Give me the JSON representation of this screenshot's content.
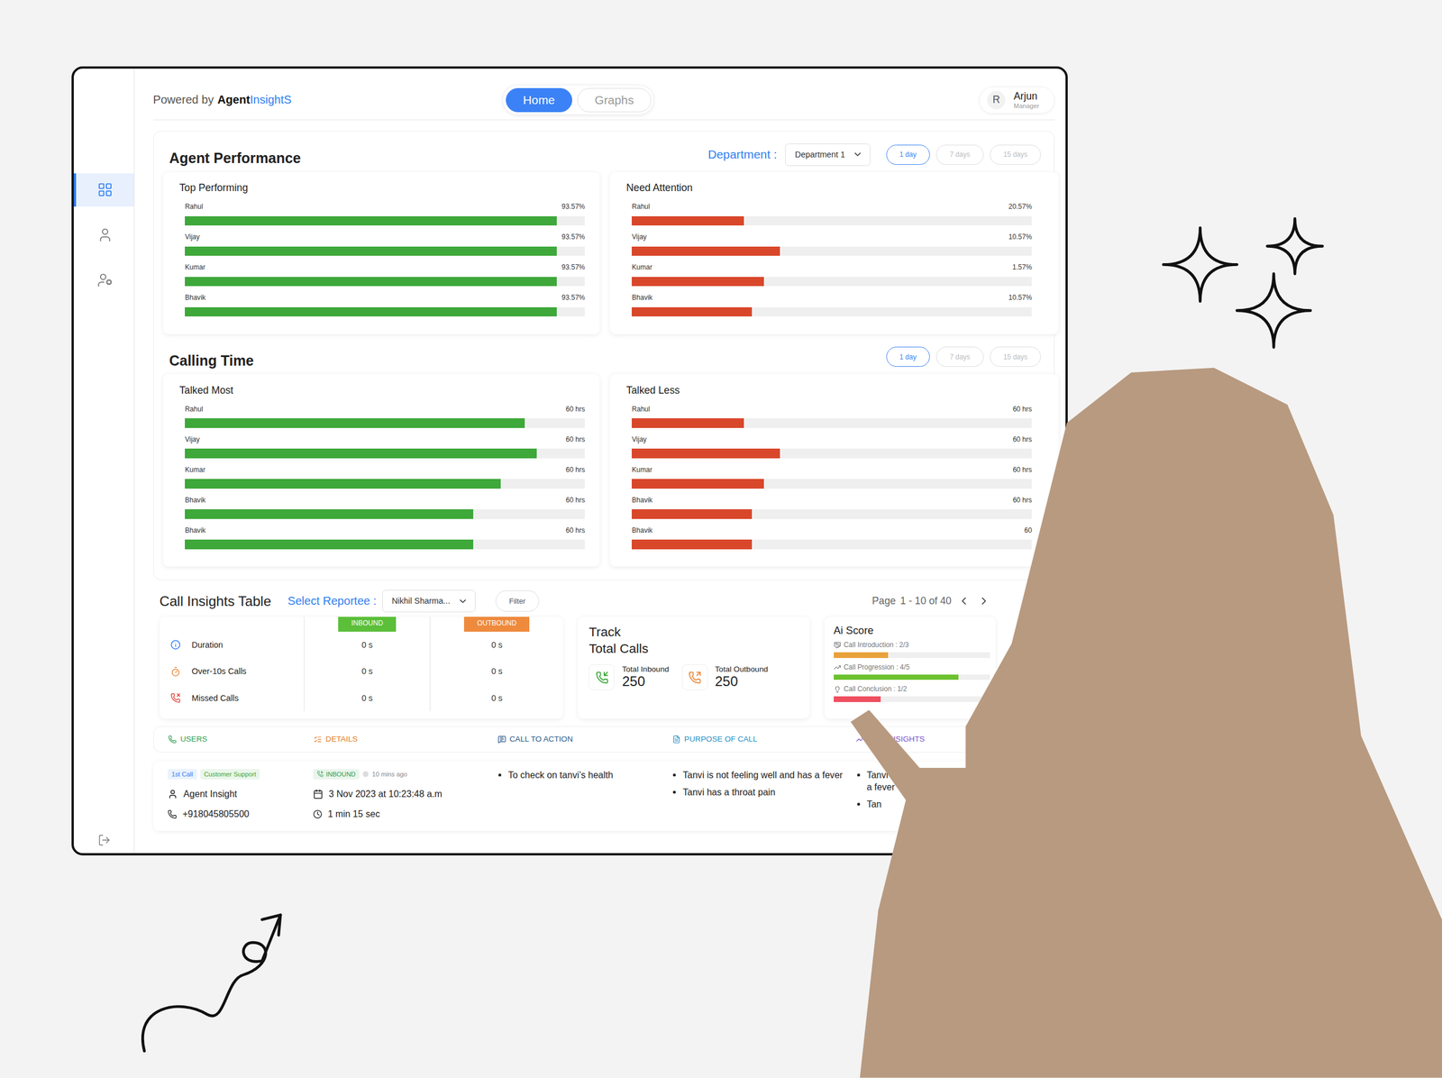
{
  "brand": {
    "prefix": "Powered by",
    "name": "Agent",
    "accent": "InsightS"
  },
  "nav_tabs": [
    {
      "label": "Home",
      "selected": true
    },
    {
      "label": "Graphs",
      "selected": false
    }
  ],
  "user": {
    "initial": "R",
    "name": "Arjun",
    "role": "Manager"
  },
  "sidebar": {
    "items": [
      {
        "kind": "dashboard",
        "selected": true
      },
      {
        "kind": "user",
        "selected": false
      },
      {
        "kind": "user-filter",
        "selected": false
      }
    ],
    "logout": {
      "kind": "logout"
    }
  },
  "agent_performance": {
    "title": "Agent Performance",
    "department_label": "Department :",
    "department_value": "Department 1",
    "ranges": [
      {
        "label": "1 day",
        "selected": true
      },
      {
        "label": "7 days",
        "selected": false
      },
      {
        "label": "15 days",
        "selected": false
      }
    ],
    "cards": [
      {
        "title": "Top Performing",
        "color": "#3ea83a",
        "rows": [
          {
            "name": "Rahul",
            "value": "93.57%",
            "level": 0.93
          },
          {
            "name": "Vijay",
            "value": "93.57%",
            "level": 0.93
          },
          {
            "name": "Kumar",
            "value": "93.57%",
            "level": 0.93
          },
          {
            "name": "Bhavik",
            "value": "93.57%",
            "level": 0.93
          }
        ]
      },
      {
        "title": "Need Attention",
        "color": "#d9472b",
        "rows": [
          {
            "name": "Rahul",
            "value": "20.57%",
            "level": 0.28
          },
          {
            "name": "Vijay",
            "value": "10.57%",
            "level": 0.37
          },
          {
            "name": "Kumar",
            "value": "1.57%",
            "level": 0.33
          },
          {
            "name": "Bhavik",
            "value": "10.57%",
            "level": 0.3
          }
        ]
      }
    ]
  },
  "calling_time": {
    "title": "Calling Time",
    "ranges": [
      {
        "label": "1 day",
        "selected": true
      },
      {
        "label": "7 days",
        "selected": false
      },
      {
        "label": "15 days",
        "selected": false
      }
    ],
    "cards": [
      {
        "title": "Talked Most",
        "color": "#3ea83a",
        "rows": [
          {
            "name": "Rahul",
            "value": "60 hrs",
            "level": 0.85
          },
          {
            "name": "Vijay",
            "value": "60 hrs",
            "level": 0.88
          },
          {
            "name": "Kumar",
            "value": "60 hrs",
            "level": 0.79
          },
          {
            "name": "Bhavik",
            "value": "60 hrs",
            "level": 0.72
          },
          {
            "name": "Bhavik",
            "value": "60 hrs",
            "level": 0.72
          }
        ]
      },
      {
        "title": "Talked Less",
        "color": "#d9472b",
        "rows": [
          {
            "name": "Rahul",
            "value": "60 hrs",
            "level": 0.28
          },
          {
            "name": "Vijay",
            "value": "60 hrs",
            "level": 0.37
          },
          {
            "name": "Kumar",
            "value": "60 hrs",
            "level": 0.33
          },
          {
            "name": "Bhavik",
            "value": "60 hrs",
            "level": 0.3
          },
          {
            "name": "Bhavik",
            "value": "60",
            "level": 0.3
          }
        ]
      }
    ]
  },
  "call_insights": {
    "title": "Call Insights Table",
    "reportee_label": "Select Reportee :",
    "reportee_value": "Nikhil Sharma...",
    "filter": "Filter",
    "pager": {
      "label": "Page",
      "range": "1 - 10 of 40"
    },
    "metrics": {
      "columns": [
        {
          "label": "INBOUND",
          "color": "#5bbf3a"
        },
        {
          "label": "OUTBOUND",
          "color": "#ee8a3c"
        }
      ],
      "rows": [
        {
          "label": "Duration",
          "inbound": "0 s",
          "outbound": "0 s",
          "color": "#2f7ff0"
        },
        {
          "label": "Over-10s Calls",
          "inbound": "0 s",
          "outbound": "0 s",
          "color": "#ee8a3c"
        },
        {
          "label": "Missed Calls",
          "inbound": "0 s",
          "outbound": "0 s",
          "color": "#e0453a"
        }
      ]
    },
    "track": {
      "title_lines": [
        "Track",
        "Total Calls"
      ],
      "items": [
        {
          "label": "Total Inbound",
          "value": "250",
          "color": "#3ea83a"
        },
        {
          "label": "Total Outbound",
          "value": "250",
          "color": "#ee8a3c"
        }
      ]
    },
    "ai_score": {
      "title": "Ai Score",
      "items": [
        {
          "label": "Call Introduction : 2/3",
          "level": 0.35,
          "color": "#e9a23b"
        },
        {
          "label": "Call Progression : 4/5",
          "level": 0.8,
          "color": "#6cc22e"
        },
        {
          "label": "Call Conclusion : 1/2",
          "level": 0.3,
          "color": "#ef4f5f"
        }
      ]
    },
    "columns": [
      {
        "label": "USERS",
        "color": "#2e9e4f"
      },
      {
        "label": "DETAILS",
        "color": "#e07b2a"
      },
      {
        "label": "CALL TO ACTION",
        "color": "#2b5a8a"
      },
      {
        "label": "PURPOSE OF CALL",
        "color": "#2a8fc4"
      },
      {
        "label": "MER INSIGHTS",
        "color": "#7b4fc9"
      }
    ],
    "record": {
      "tags": [
        {
          "label": "1st Call",
          "color": "#2f7ff0"
        },
        {
          "label": "Customer Support",
          "color": "#3ea83a"
        }
      ],
      "agent": "Agent Insight",
      "phone": "+918045805500",
      "direction": "INBOUND",
      "ago": "10 mins ago",
      "date": "3 Nov 2023 at 10:23:48 a.m",
      "duration": "1 min 15 sec",
      "call_to_action": [
        "To check on tanvi’s health"
      ],
      "purpose": [
        "Tanvi is not feeling well and has a fever",
        "Tanvi has a throat pain"
      ],
      "customer_insights": [
        {
          "lines": [
            "Tanvi i",
            "a fever"
          ]
        },
        {
          "lines": [
            "Tan"
          ]
        }
      ]
    }
  }
}
